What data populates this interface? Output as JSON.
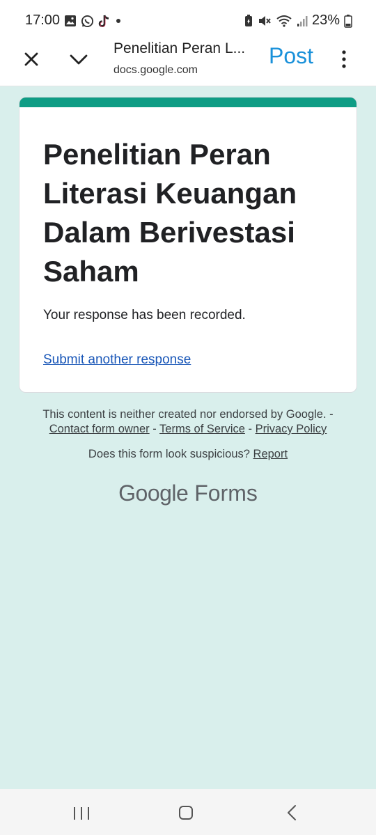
{
  "status_bar": {
    "time": "17:00",
    "notification_icons": [
      "gallery-icon",
      "whatsapp-icon",
      "tiktok-icon",
      "dot-icon"
    ],
    "system_icons": [
      "battery-saver-icon",
      "mute-icon",
      "wifi-icon",
      "signal-icon"
    ],
    "battery_percent": "23%"
  },
  "browser_bar": {
    "page_title": "Penelitian Peran L...",
    "url": "docs.google.com",
    "post_label": "Post"
  },
  "form_card": {
    "accent_color": "#0f9d85",
    "title": "Penelitian Peran Literasi Keuangan Dalam Berivestasi Saham",
    "message": "Your response has been recorded.",
    "submit_another": "Submit another response"
  },
  "footer": {
    "disclaimer": "This content is neither created nor endorsed by Google. -",
    "contact_owner": "Contact form owner",
    "separator_1": " - ",
    "terms": "Terms of Service",
    "separator_2": " - ",
    "privacy": "Privacy Policy",
    "suspicious_question": "Does this form look suspicious?",
    "report": "Report",
    "brand_google": "Google",
    "brand_forms": "Forms"
  },
  "nav_bar": {
    "icons": [
      "recent-apps-icon",
      "home-icon",
      "back-icon"
    ]
  }
}
